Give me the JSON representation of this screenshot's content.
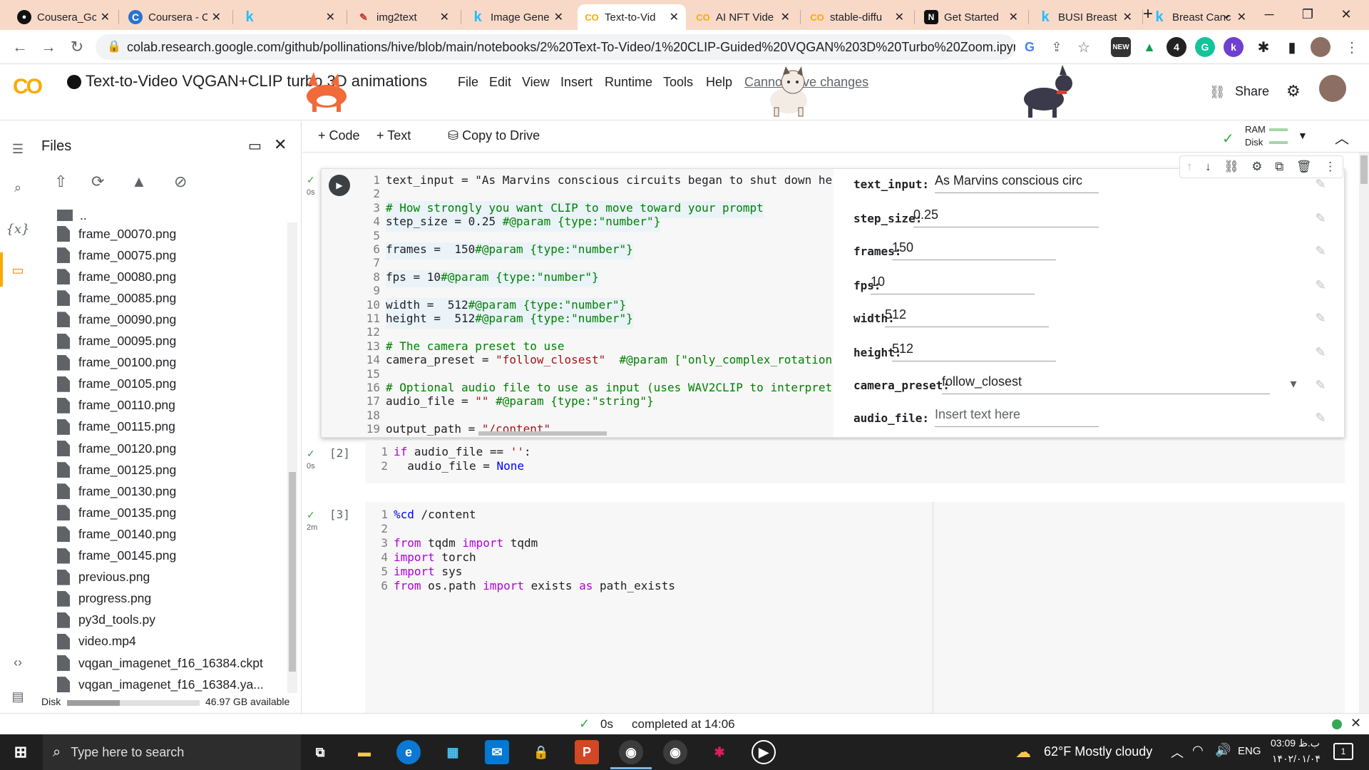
{
  "browser": {
    "tabs": [
      {
        "title": "Cousera_Go",
        "icon": "github-icon"
      },
      {
        "title": "Coursera - C",
        "icon": "coursera-icon"
      },
      {
        "title": "",
        "icon": "kaggle-icon"
      },
      {
        "title": "img2text",
        "icon": "pencil-icon"
      },
      {
        "title": "Image Gene",
        "icon": "kaggle-icon"
      },
      {
        "title": "Text-to-Vid",
        "icon": "colab-icon"
      },
      {
        "title": "AI NFT Vide",
        "icon": "colab-icon"
      },
      {
        "title": "stable-diffu",
        "icon": "colab-icon"
      },
      {
        "title": "Get Started",
        "icon": "notion-icon"
      },
      {
        "title": "BUSI Breast",
        "icon": "kaggle-icon"
      },
      {
        "title": "Breast Canc",
        "icon": "kaggle-icon"
      }
    ],
    "new_tab": "+",
    "url": "colab.research.google.com/github/pollinations/hive/blob/main/notebooks/2%20Text-To-Video/1%20CLIP-Guided%20VQGAN%203D%20Turbo%20Zoom.ipyn..."
  },
  "colab": {
    "logo": "CO",
    "title": "Text-to-Video VQGAN+CLIP turbo 3D animations",
    "menu": [
      "File",
      "Edit",
      "View",
      "Insert",
      "Runtime",
      "Tools",
      "Help"
    ],
    "cannot_save": "Cannot save changes",
    "share": "Share"
  },
  "sidebar": {
    "title": "Files",
    "parent": "..",
    "files": [
      "frame_00070.png",
      "frame_00075.png",
      "frame_00080.png",
      "frame_00085.png",
      "frame_00090.png",
      "frame_00095.png",
      "frame_00100.png",
      "frame_00105.png",
      "frame_00110.png",
      "frame_00115.png",
      "frame_00120.png",
      "frame_00125.png",
      "frame_00130.png",
      "frame_00135.png",
      "frame_00140.png",
      "frame_00145.png",
      "previous.png",
      "progress.png",
      "py3d_tools.py",
      "video.mp4",
      "vqgan_imagenet_f16_16384.ckpt",
      "vqgan_imagenet_f16_16384.ya..."
    ],
    "disk_label": "Disk",
    "disk_available": "46.97 GB available",
    "disk_used_fraction": 0.4
  },
  "toolbar": {
    "code": "Code",
    "text": "Text",
    "copy_to_drive": "Copy to Drive",
    "ram": "RAM",
    "disk": "Disk"
  },
  "cell1": {
    "exec_time": "0s",
    "lines": [
      {
        "n": "1",
        "code": "text_input = \"As Marvins conscious circuits began to shut down her"
      },
      {
        "n": "2",
        "code": ""
      },
      {
        "n": "3",
        "code": "# How strongly you want CLIP to move toward your prompt"
      },
      {
        "n": "4",
        "code": "step_size = 0.25 #@param {type:\"number\"}"
      },
      {
        "n": "5",
        "code": ""
      },
      {
        "n": "6",
        "code": "frames =  150#@param {type:\"number\"}"
      },
      {
        "n": "7",
        "code": ""
      },
      {
        "n": "8",
        "code": "fps = 10#@param {type:\"number\"}"
      },
      {
        "n": "9",
        "code": ""
      },
      {
        "n": "10",
        "code": "width =  512#@param {type:\"number\"}"
      },
      {
        "n": "11",
        "code": "height =  512#@param {type:\"number\"}"
      },
      {
        "n": "12",
        "code": ""
      },
      {
        "n": "13",
        "code": "# The camera preset to use"
      },
      {
        "n": "14",
        "code": "camera_preset = \"follow_closest\"  #@param [\"only_complex_rotation\""
      },
      {
        "n": "15",
        "code": ""
      },
      {
        "n": "16",
        "code": "# Optional audio file to use as input (uses WAV2CLIP to interpret"
      },
      {
        "n": "17",
        "code": "audio_file = \"\" #@param {type:\"string\"}"
      },
      {
        "n": "18",
        "code": ""
      },
      {
        "n": "19",
        "code": "output_path = \"/content\""
      }
    ],
    "form": [
      {
        "label": "text_input:",
        "value": "As Marvins conscious circ"
      },
      {
        "label": "step_size:",
        "value": "0.25"
      },
      {
        "label": "frames:",
        "value": "150"
      },
      {
        "label": "fps:",
        "value": "10"
      },
      {
        "label": "width:",
        "value": "512"
      },
      {
        "label": "height:",
        "value": "512"
      },
      {
        "label": "camera_preset:",
        "value": "follow_closest"
      },
      {
        "label": "audio_file:",
        "value": "Insert text here"
      }
    ]
  },
  "cell2": {
    "exec_count": "[2]",
    "exec_time": "0s",
    "lines": [
      {
        "n": "1",
        "code": "if audio_file == '':"
      },
      {
        "n": "2",
        "code": "  audio_file = None"
      }
    ]
  },
  "cell3": {
    "exec_count": "[3]",
    "exec_time": "2m",
    "lines": [
      {
        "n": "1",
        "code": "%cd /content"
      },
      {
        "n": "2",
        "code": ""
      },
      {
        "n": "3",
        "code": "from tqdm import tqdm"
      },
      {
        "n": "4",
        "code": "import torch"
      },
      {
        "n": "5",
        "code": "import sys"
      },
      {
        "n": "6",
        "code": "from os.path import exists as path_exists"
      }
    ]
  },
  "statusbar": {
    "time": "0s",
    "completed": "completed at 14:06"
  },
  "taskbar": {
    "search_placeholder": "Type here to search",
    "weather": "62°F  Mostly cloudy",
    "lang": "ENG",
    "clock_time": "03:09 ب.ظ",
    "clock_date": "۱۴۰۲/۰۱/۰۴",
    "notification_count": "1"
  }
}
